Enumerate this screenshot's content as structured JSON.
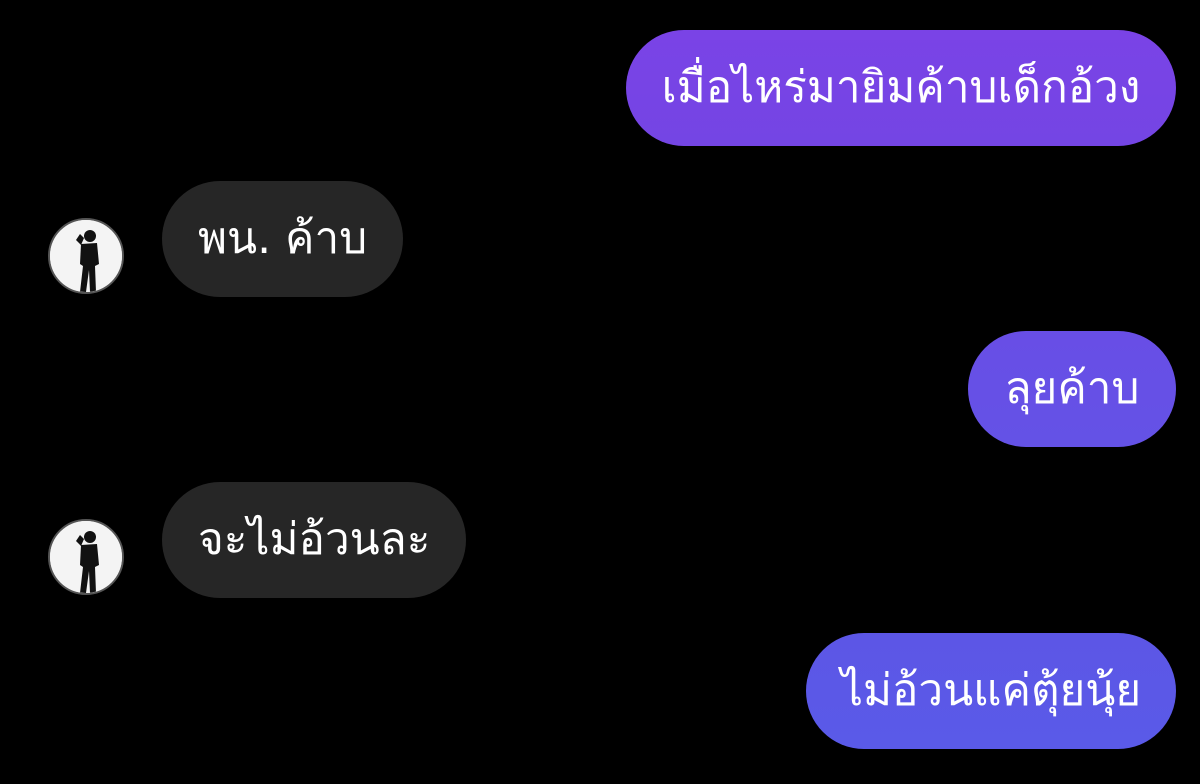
{
  "colors": {
    "background": "#000000",
    "received_bubble": "#262626",
    "sent_gradient_top": "#7a45e6",
    "sent_gradient_bottom": "#5b5de8",
    "text": "#ffffff"
  },
  "messages": [
    {
      "direction": "sent",
      "text": "เมื่อไหร่มายิมค้าบเด็กอ้วง"
    },
    {
      "direction": "received",
      "text": "พน. ค้าบ",
      "avatar_icon": "profile-avatar-icon"
    },
    {
      "direction": "sent",
      "text": "ลุยค้าบ"
    },
    {
      "direction": "received",
      "text": "จะไม่อ้วนละ",
      "avatar_icon": "profile-avatar-icon"
    },
    {
      "direction": "sent",
      "text": "ไม่อ้วนแค่ตุ้ยนุ้ย"
    }
  ]
}
